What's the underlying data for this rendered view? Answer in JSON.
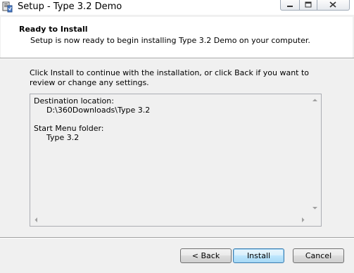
{
  "window": {
    "title": "Setup - Type 3.2 Demo",
    "icon": "setup-installer-icon",
    "controls": [
      "minimize-icon",
      "maximize-icon",
      "close-icon"
    ]
  },
  "header": {
    "title": "Ready to Install",
    "subtitle": "Setup is now ready to begin installing Type 3.2 Demo on your computer."
  },
  "main": {
    "instructions": "Click Install to continue with the installation, or click Back if you want to review or change any settings.",
    "summary": {
      "destination_label": "Destination location:",
      "destination_value": "D:\\360Downloads\\Type 3.2",
      "start_menu_label": "Start Menu folder:",
      "start_menu_value": "Type 3.2"
    }
  },
  "buttons": {
    "back": "< Back",
    "install": "Install",
    "cancel": "Cancel"
  },
  "colors": {
    "accent_border": "#3c7fb1",
    "close_red": "#c7463c"
  }
}
